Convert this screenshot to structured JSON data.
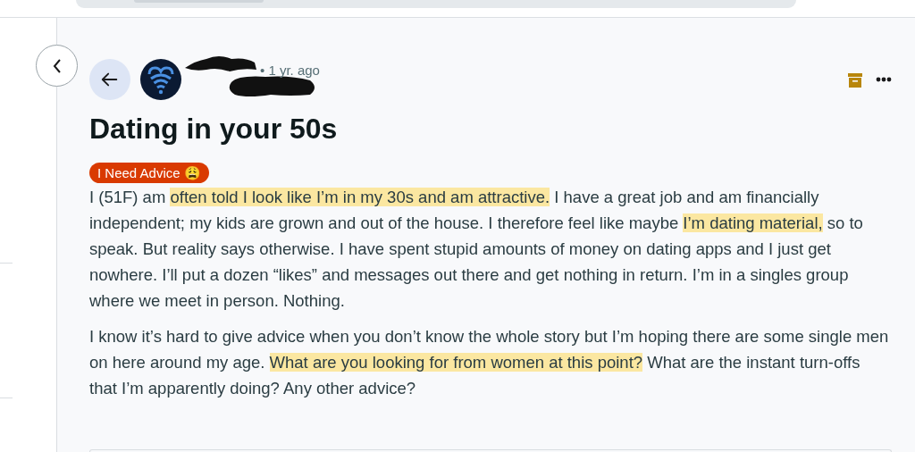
{
  "post": {
    "time": "• 1 yr. ago",
    "title": "Dating in your 50s",
    "flair": "I Need Advice 😩",
    "paragraphs": [
      [
        {
          "text": "I (51F) am ",
          "highlighted": false
        },
        {
          "text": "often told I look like I’m in my 30s and am attractive.",
          "highlighted": true
        },
        {
          "text": " I have a great job and am financially independent; my kids are grown and out of the house. I therefore feel like maybe ",
          "highlighted": false
        },
        {
          "text": "I’m dating material,",
          "highlighted": true
        },
        {
          "text": " so to speak. But reality says otherwise. I have spent stupid amounts of money on dating apps and I just get nowhere. I’ll put a dozen “likes” and messages out there and get nothing in return. I’m in a singles group where we meet in person. Nothing.",
          "highlighted": false
        }
      ],
      [
        {
          "text": "I know it’s hard to give advice when you don’t know the whole story but I’m hoping there are some single men on here around my age. ",
          "highlighted": false
        },
        {
          "text": "What are you looking for from women at this point?",
          "highlighted": true
        },
        {
          "text": " What are the instant turn-offs that I’m apparently doing? Any other advice?",
          "highlighted": false
        }
      ]
    ]
  }
}
